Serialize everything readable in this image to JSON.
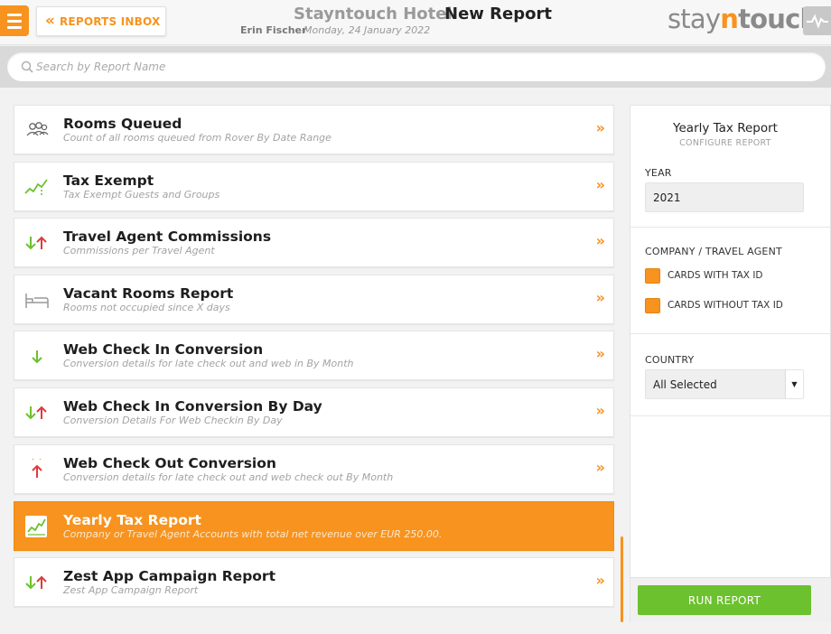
{
  "header": {
    "menu_icon": "hamburger-icon",
    "inbox_label": "REPORTS INBOX",
    "hotel_name": "Stayntouch Hotel",
    "page_title": "New Report",
    "user_name": "Erin Fischer",
    "date": "Monday, 24 January 2022",
    "logo_text_1": "stay",
    "logo_text_2": "n",
    "logo_text_3": "touch",
    "accent_color": "#f7931e"
  },
  "search": {
    "placeholder": "Search by Report Name",
    "value": ""
  },
  "reports": [
    {
      "name": "Rooms Queued",
      "desc": "Count of all rooms queued from Rover By Date Range",
      "icon": "queue-people-icon"
    },
    {
      "name": "Tax Exempt",
      "desc": "Tax Exempt Guests and Groups",
      "icon": "trend-chart-icon"
    },
    {
      "name": "Travel Agent Commissions",
      "desc": "Commissions per Travel Agent",
      "icon": "up-down-arrows-icon"
    },
    {
      "name": "Vacant Rooms Report",
      "desc": "Rooms not occupied since X days",
      "icon": "bed-icon"
    },
    {
      "name": "Web Check In Conversion",
      "desc": "Conversion details for late check out and web in By Month",
      "icon": "down-arrow-icon"
    },
    {
      "name": "Web Check In Conversion By Day",
      "desc": "Conversion Details For Web Checkin By Day",
      "icon": "up-down-arrows-icon"
    },
    {
      "name": "Web Check Out Conversion",
      "desc": "Conversion details for late check out and web check out By Month",
      "icon": "up-arrow-icon"
    },
    {
      "name": "Yearly Tax Report",
      "desc": "Company or Travel Agent Accounts with total net revenue over EUR 250.00.",
      "icon": "trend-chart-icon",
      "selected": true
    },
    {
      "name": "Zest App Campaign Report",
      "desc": "Zest App Campaign Report",
      "icon": "up-down-arrows-icon"
    }
  ],
  "panel": {
    "title": "Yearly Tax Report",
    "subtitle": "CONFIGURE REPORT",
    "year_label": "YEAR",
    "year_value": "2021",
    "company_label": "COMPANY / TRAVEL AGENT",
    "option_with_tax": "CARDS WITH TAX ID",
    "option_without_tax": "CARDS WITHOUT TAX ID",
    "country_label": "COUNTRY",
    "country_value": "All Selected",
    "run_label": "RUN REPORT"
  }
}
